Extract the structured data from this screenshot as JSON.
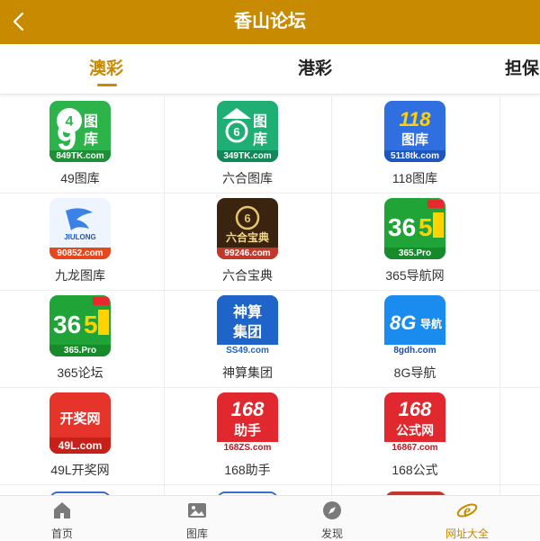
{
  "header": {
    "title": "香山论坛"
  },
  "tabs": [
    {
      "label": "澳彩"
    },
    {
      "label": "港彩"
    },
    {
      "label": "担保"
    }
  ],
  "sites": [
    {
      "label": "49图库",
      "band": "849TK.com",
      "big": "9图库",
      "color": "#2cb34a",
      "band_color": "#1f8f37"
    },
    {
      "label": "六合图库",
      "band": "349TK.com",
      "big": "图库",
      "color": "#1fae73",
      "band_color": "#12875a"
    },
    {
      "label": "118图库",
      "band": "5118tk.com",
      "big": "118",
      "sub": "图库",
      "color": "#2f6fe0",
      "band_color": "#1d56c0"
    },
    {
      "label": "九龙图库",
      "band": "90852.com",
      "big": "JIULONG",
      "color": "#4a8ee8",
      "band_color": "#e8471e"
    },
    {
      "label": "六合宝典",
      "band": "99246.com",
      "big": "六合宝典",
      "color": "#3a2410",
      "band_color": "#c0392b"
    },
    {
      "label": "365导航网",
      "band": "365.Pro",
      "big": "365",
      "color": "#20a437",
      "band_color": "#178a2b"
    },
    {
      "label": "365论坛",
      "band": "365.Pro",
      "big": "365",
      "color": "#20a437",
      "band_color": "#178a2b"
    },
    {
      "label": "神算集团",
      "band": "SS49.com",
      "big": "神算集团",
      "color": "#1f64c8",
      "band_color": "#ffffff"
    },
    {
      "label": "8G导航",
      "band": "8gdh.com",
      "big": "8G导航",
      "color": "#1a8cf0",
      "band_color": "#ffffff"
    },
    {
      "label": "49L开奖网",
      "band": "49L.com",
      "big": "开奖网",
      "color": "#e5352b",
      "band_color": "#c62018"
    },
    {
      "label": "168助手",
      "band": "168ZS.com",
      "big": "168",
      "sub": "助手",
      "color": "#e0282e",
      "band_color": "#ffffff"
    },
    {
      "label": "168公式",
      "band": "16867.com",
      "big": "168",
      "sub": "公式网",
      "color": "#e0282e",
      "band_color": "#ffffff"
    }
  ],
  "bottom_nav": [
    {
      "label": "首页",
      "icon": "home-icon"
    },
    {
      "label": "图库",
      "icon": "image-icon"
    },
    {
      "label": "发现",
      "icon": "compass-icon"
    },
    {
      "label": "网址大全",
      "icon": "browser-e-icon"
    }
  ],
  "colors": {
    "brand": "#c78a00"
  }
}
